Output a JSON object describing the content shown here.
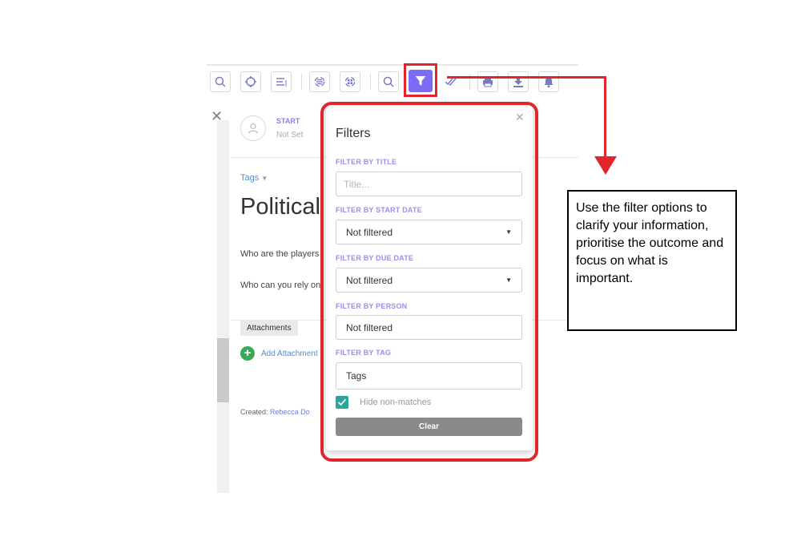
{
  "toolbar": {
    "icons": [
      "zoom-icon",
      "target-icon",
      "outline-icon",
      "expand-icon",
      "reorganize-icon",
      "search-icon",
      "filter-icon",
      "check-all-icon",
      "print-icon",
      "download-icon",
      "bell-icon"
    ]
  },
  "card": {
    "start_label": "START",
    "start_value": "Not Set",
    "tags_link": "Tags",
    "title": "Political",
    "question_1": "Who are the players",
    "question_2": "Who can you rely on",
    "attachments_tab": "Attachments",
    "add_attachment": "Add Attachment",
    "created_label": "Created:",
    "created_by": "Rebecca Do"
  },
  "filters": {
    "title": "Filters",
    "by_title_label": "FILTER BY TITLE",
    "by_title_placeholder": "Title...",
    "by_start_label": "FILTER BY START DATE",
    "by_start_value": "Not filtered",
    "by_due_label": "FILTER BY DUE DATE",
    "by_due_value": "Not filtered",
    "by_person_label": "FILTER BY PERSON",
    "by_person_value": "Not filtered",
    "by_tag_label": "FILTER BY TAG",
    "by_tag_value": "Tags",
    "hide_label": "Hide non-matches",
    "hide_checked": true,
    "clear_label": "Clear"
  },
  "callout": {
    "text": "Use the filter options to clarify your information, prioritise the outcome and focus on what is important."
  },
  "colors": {
    "accent": "#7b6cf6",
    "highlight": "#e0252b",
    "checkbox": "#2aa69a",
    "clear_button": "#8a8a8a"
  }
}
